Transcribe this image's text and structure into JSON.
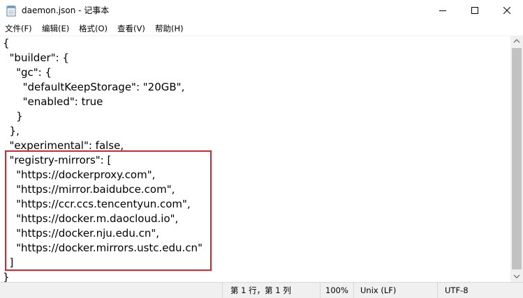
{
  "window": {
    "title": "daemon.json - 记事本"
  },
  "menu": {
    "items": [
      {
        "label": "文件(F)"
      },
      {
        "label": "编辑(E)"
      },
      {
        "label": "格式(O)"
      },
      {
        "label": "查看(V)"
      },
      {
        "label": "帮助(H)"
      }
    ]
  },
  "editor": {
    "lines": [
      "{",
      "  \"builder\": {",
      "    \"gc\": {",
      "      \"defaultKeepStorage\": \"20GB\",",
      "      \"enabled\": true",
      "    }",
      "  },",
      "  \"experimental\": false,",
      "  \"registry-mirrors\": [",
      "    \"https://dockerproxy.com\",",
      "    \"https://mirror.baidubce.com\",",
      "    \"https://ccr.ccs.tencentyun.com\",",
      "    \"https://docker.m.daocloud.io\",",
      "    \"https://docker.nju.edu.cn\",",
      "    \"https://docker.mirrors.ustc.edu.cn\"",
      "  ]",
      "}"
    ],
    "highlight_color": "#d9262b"
  },
  "status": {
    "position": "第 1 行，第 1 列",
    "zoom": "100%",
    "line_ending": "Unix (LF)",
    "encoding": "UTF-8"
  },
  "icons": {
    "app": "notepad-icon",
    "minimize": "minimize-icon",
    "maximize": "maximize-icon",
    "close": "close-icon"
  }
}
